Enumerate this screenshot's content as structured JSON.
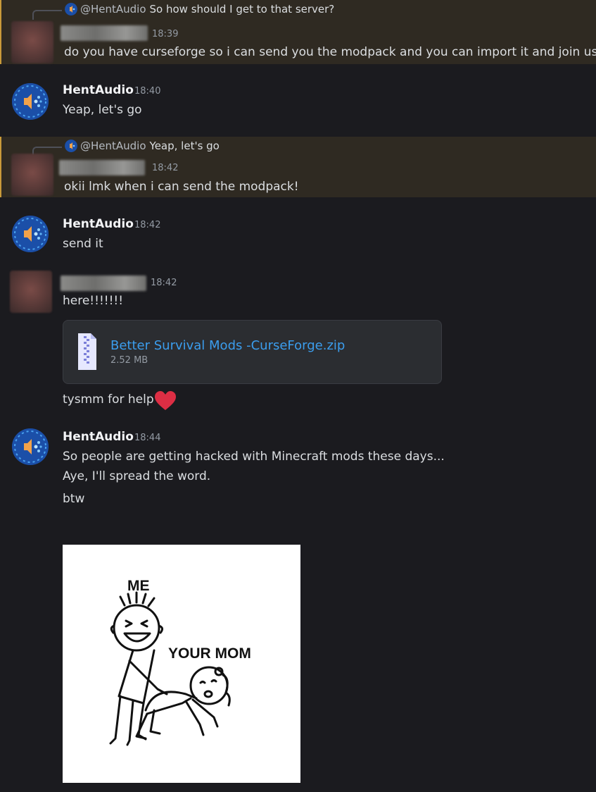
{
  "messages": {
    "m1": {
      "reply_mention": "@HentAudio",
      "reply_text": "So how should I get to that server?",
      "time": "18:39",
      "text": "do you have curseforge so i can send you the modpack and you can import it and join us?"
    },
    "m2": {
      "author": "HentAudio",
      "time": "18:40",
      "text": "Yeap, let's go"
    },
    "m3": {
      "reply_mention": "@HentAudio",
      "reply_text": "Yeap, let's go",
      "time": "18:42",
      "text": "okii lmk when i can send the modpack!"
    },
    "m4": {
      "author": "HentAudio",
      "time": "18:42",
      "text": "send it"
    },
    "m5": {
      "time": "18:42",
      "text": "here!!!!!!!",
      "attachment": {
        "file_name": "Better Survival Mods -CurseForge.zip",
        "file_size": "2.52 MB",
        "icon": "zip-file-icon"
      },
      "text2": "tysmm for help",
      "emoji": "heart-emoji"
    },
    "m6": {
      "author": "HentAudio",
      "time": "18:44",
      "lines": [
        "So people are getting hacked with Minecraft mods these days...",
        "Aye, I'll spread the word.",
        "btw"
      ],
      "image": {
        "label_me": "ME",
        "label_other": "YOUR MOM"
      }
    }
  },
  "colors": {
    "background": "#1b1b1f",
    "highlight": "#2f2a22",
    "highlight_border": "#c99a3a",
    "link": "#3b9ded",
    "timestamp": "#949ba4",
    "heart": "#dd2e44"
  }
}
